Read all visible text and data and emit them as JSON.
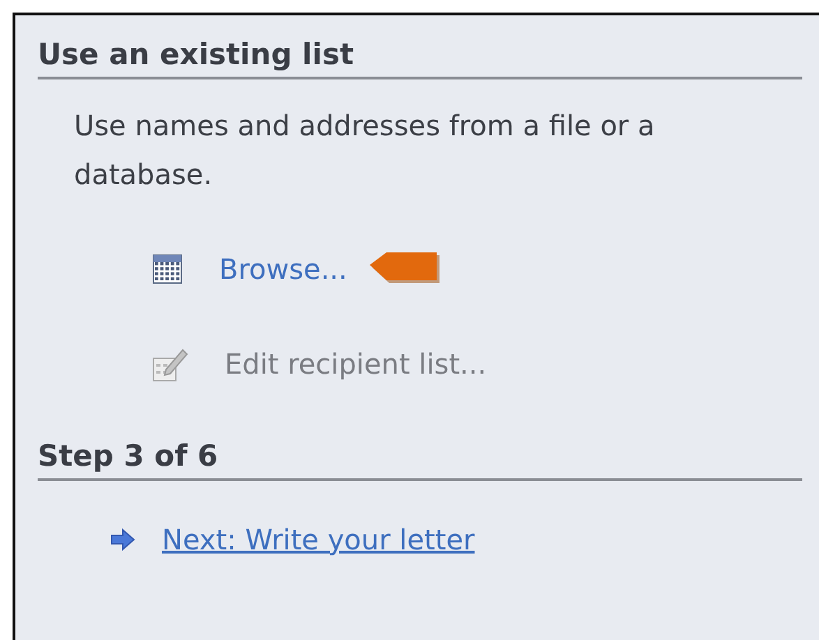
{
  "sections": [
    {
      "heading": "Use an existing list",
      "description": "Use names and addresses from a file or a database.",
      "actions": [
        {
          "kind": "browse",
          "label": "Browse...",
          "disabled": false,
          "highlighted": true
        },
        {
          "kind": "edit",
          "label": "Edit recipient list...",
          "disabled": true,
          "highlighted": false
        }
      ]
    },
    {
      "heading": "Step 3 of 6",
      "actions": [
        {
          "kind": "next",
          "label": "Next: Write your letter",
          "disabled": false,
          "highlighted": false
        }
      ]
    }
  ]
}
